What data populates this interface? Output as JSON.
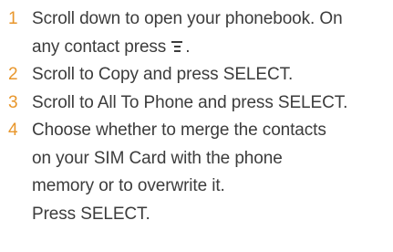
{
  "steps": [
    {
      "number": "1",
      "lines": [
        "Scroll down to open your phonebook. On",
        "any contact press",
        "."
      ],
      "icon": "menu-options-icon"
    },
    {
      "number": "2",
      "lines": [
        "Scroll to Copy and press SELECT."
      ]
    },
    {
      "number": "3",
      "lines": [
        "Scroll to All To Phone and press SELECT."
      ]
    },
    {
      "number": "4",
      "lines": [
        "Choose whether to merge the contacts",
        "on your SIM Card with the phone",
        "memory or to overwrite it.",
        "Press SELECT."
      ]
    }
  ],
  "colors": {
    "number": "#e8962b",
    "text": "#3c3c3c"
  }
}
